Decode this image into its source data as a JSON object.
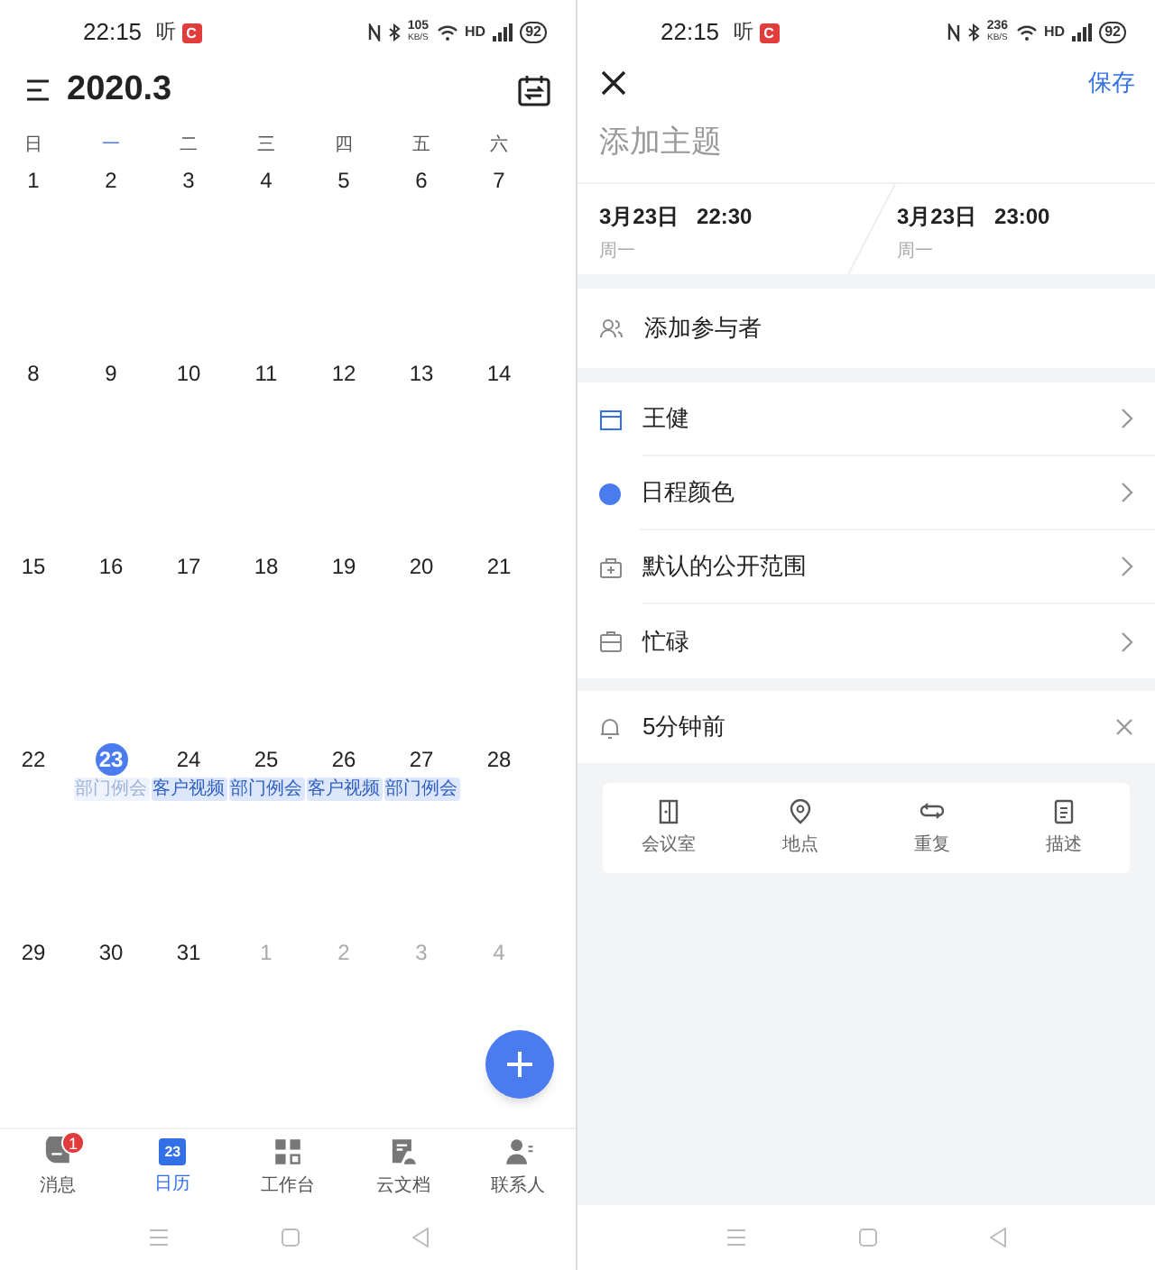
{
  "status_bars": [
    {
      "time": "22:15",
      "app_glyph": "听",
      "badge": "C",
      "speed": "105",
      "speed_unit": "KB/S",
      "network": "HD",
      "battery": "92"
    },
    {
      "time": "22:15",
      "app_glyph": "听",
      "badge": "C",
      "speed": "236",
      "speed_unit": "KB/S",
      "network": "HD",
      "battery": "92"
    }
  ],
  "calendar": {
    "title": "2020.3",
    "weekdays": [
      {
        "label": "日",
        "selected": false
      },
      {
        "label": "一",
        "selected": true
      },
      {
        "label": "二",
        "selected": false
      },
      {
        "label": "三",
        "selected": false
      },
      {
        "label": "四",
        "selected": false
      },
      {
        "label": "五",
        "selected": false
      },
      {
        "label": "六",
        "selected": false
      }
    ],
    "weeks": [
      [
        {
          "day": "1",
          "muted": false,
          "today": false
        },
        {
          "day": "2",
          "muted": false,
          "today": false
        },
        {
          "day": "3",
          "muted": false,
          "today": false
        },
        {
          "day": "4",
          "muted": false,
          "today": false
        },
        {
          "day": "5",
          "muted": false,
          "today": false
        },
        {
          "day": "6",
          "muted": false,
          "today": false
        },
        {
          "day": "7",
          "muted": false,
          "today": false
        }
      ],
      [
        {
          "day": "8",
          "muted": false,
          "today": false
        },
        {
          "day": "9",
          "muted": false,
          "today": false
        },
        {
          "day": "10",
          "muted": false,
          "today": false
        },
        {
          "day": "11",
          "muted": false,
          "today": false
        },
        {
          "day": "12",
          "muted": false,
          "today": false
        },
        {
          "day": "13",
          "muted": false,
          "today": false
        },
        {
          "day": "14",
          "muted": false,
          "today": false
        }
      ],
      [
        {
          "day": "15",
          "muted": false,
          "today": false
        },
        {
          "day": "16",
          "muted": false,
          "today": false
        },
        {
          "day": "17",
          "muted": false,
          "today": false
        },
        {
          "day": "18",
          "muted": false,
          "today": false
        },
        {
          "day": "19",
          "muted": false,
          "today": false
        },
        {
          "day": "20",
          "muted": false,
          "today": false
        },
        {
          "day": "21",
          "muted": false,
          "today": false
        }
      ],
      [
        {
          "day": "22",
          "muted": false,
          "today": false
        },
        {
          "day": "23",
          "muted": false,
          "today": true,
          "events": [
            {
              "label": "部门例会",
              "past": true
            }
          ]
        },
        {
          "day": "24",
          "muted": false,
          "today": false,
          "events": [
            {
              "label": "客户视频",
              "past": false
            }
          ]
        },
        {
          "day": "25",
          "muted": false,
          "today": false,
          "events": [
            {
              "label": "部门例会",
              "past": false
            }
          ]
        },
        {
          "day": "26",
          "muted": false,
          "today": false,
          "events": [
            {
              "label": "客户视频",
              "past": false
            }
          ]
        },
        {
          "day": "27",
          "muted": false,
          "today": false,
          "events": [
            {
              "label": "部门例会",
              "past": false
            }
          ]
        },
        {
          "day": "28",
          "muted": false,
          "today": false
        }
      ],
      [
        {
          "day": "29",
          "muted": false,
          "today": false
        },
        {
          "day": "30",
          "muted": false,
          "today": false
        },
        {
          "day": "31",
          "muted": false,
          "today": false
        },
        {
          "day": "1",
          "muted": true,
          "today": false
        },
        {
          "day": "2",
          "muted": true,
          "today": false
        },
        {
          "day": "3",
          "muted": true,
          "today": false
        },
        {
          "day": "4",
          "muted": true,
          "today": false
        }
      ]
    ]
  },
  "bottom_nav": [
    {
      "kind": "messages",
      "label": "消息",
      "selected": false,
      "badge": "1"
    },
    {
      "kind": "calendar",
      "label": "日历",
      "selected": true,
      "icon_text": "23"
    },
    {
      "kind": "workbench",
      "label": "工作台",
      "selected": false
    },
    {
      "kind": "docs",
      "label": "云文档",
      "selected": false
    },
    {
      "kind": "contacts",
      "label": "联系人",
      "selected": false
    }
  ],
  "editor": {
    "save": "保存",
    "title_placeholder": "添加主题",
    "start": {
      "date": "3月23日",
      "time": "22:30",
      "weekday": "周一"
    },
    "end": {
      "date": "3月23日",
      "time": "23:00",
      "weekday": "周一"
    },
    "attendees": "添加参与者",
    "rows": [
      {
        "kind": "calendar",
        "label": "王健"
      },
      {
        "kind": "color",
        "label": "日程颜色",
        "color": "#4a7cf0"
      },
      {
        "kind": "visibility",
        "label": "默认的公开范围"
      },
      {
        "kind": "busy",
        "label": "忙碌"
      }
    ],
    "reminder": {
      "label": "5分钟前",
      "clearable": true
    },
    "quick_actions": [
      {
        "kind": "room",
        "label": "会议室"
      },
      {
        "kind": "location",
        "label": "地点"
      },
      {
        "kind": "repeat",
        "label": "重复"
      },
      {
        "kind": "description",
        "label": "描述"
      }
    ]
  }
}
